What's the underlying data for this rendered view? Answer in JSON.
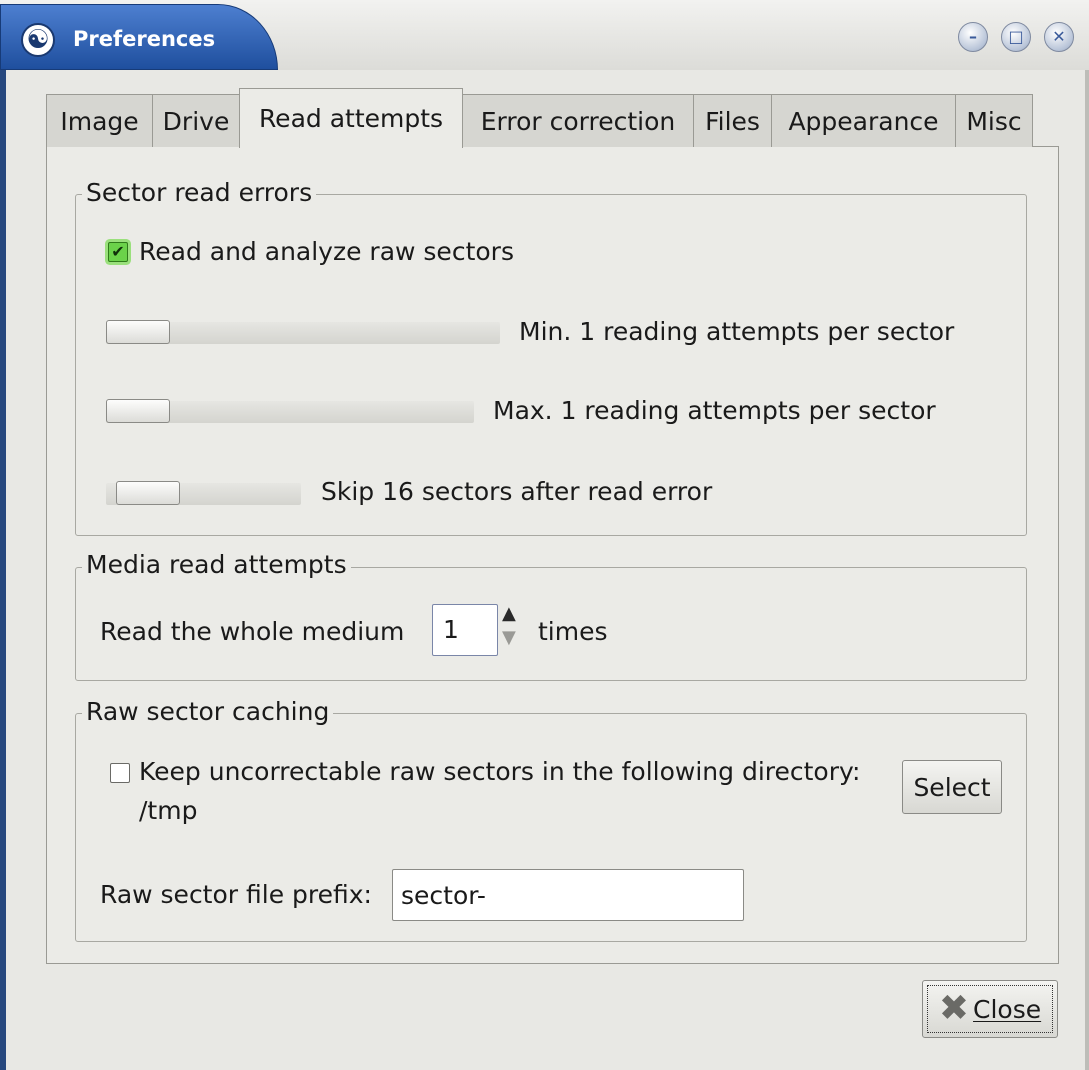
{
  "window": {
    "title": "Preferences",
    "app_icon": "yin-yang-icon",
    "controls": {
      "minimize": "–",
      "maximize": "□",
      "close": "✕"
    }
  },
  "tabs": [
    {
      "label": "Image",
      "active": false
    },
    {
      "label": "Drive",
      "active": false
    },
    {
      "label": "Read attempts",
      "active": true
    },
    {
      "label": "Error correction",
      "active": false
    },
    {
      "label": "Files",
      "active": false
    },
    {
      "label": "Appearance",
      "active": false
    },
    {
      "label": "Misc",
      "active": false
    }
  ],
  "sector_read_errors": {
    "title": "Sector read errors",
    "raw_checkbox": {
      "label": "Read and analyze raw sectors",
      "checked": true
    },
    "min_slider": {
      "label": "Min. 1 reading attempts per sector",
      "value": 1
    },
    "max_slider": {
      "label": "Max. 1 reading attempts per sector",
      "value": 1
    },
    "skip_slider": {
      "label": "Skip 16 sectors after read error",
      "value": 16
    }
  },
  "media_read_attempts": {
    "title": "Media read attempts",
    "prefix": "Read the whole medium",
    "value": "1",
    "suffix": "times"
  },
  "raw_sector_caching": {
    "title": "Raw sector caching",
    "keep_checkbox": {
      "label": "Keep uncorrectable raw sectors in the following directory:",
      "checked": false
    },
    "directory": "/tmp",
    "select_button": "Select",
    "prefix_label": "Raw sector file prefix:",
    "prefix_value": "sector-"
  },
  "footer": {
    "close_button": "Close"
  }
}
